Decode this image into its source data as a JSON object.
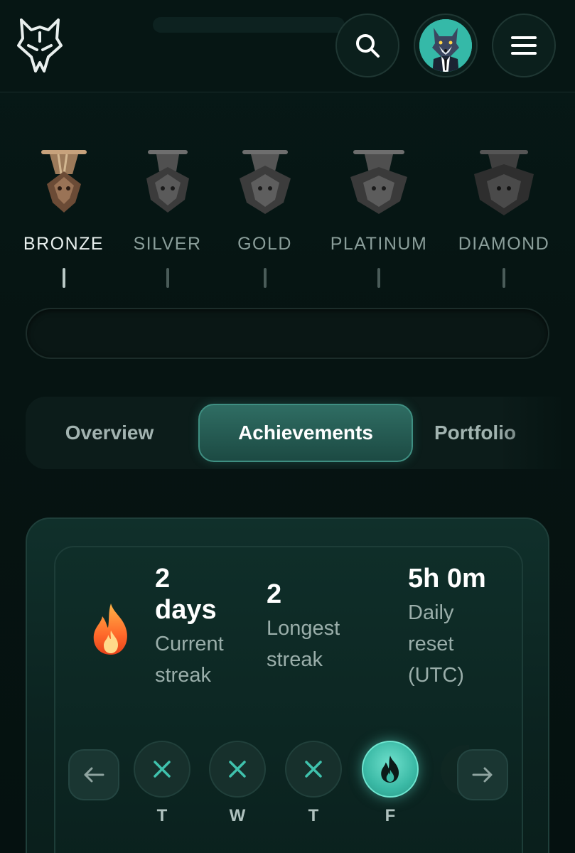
{
  "header": {
    "logo_icon": "wolf-logo-icon",
    "search_icon": "search-icon",
    "avatar_icon": "wolf-avatar",
    "menu_icon": "hamburger-menu-icon"
  },
  "tiers": [
    {
      "label": "BRONZE",
      "active": true,
      "color": "#8a6a4e"
    },
    {
      "label": "SILVER",
      "active": false,
      "color": "#6a6a6a"
    },
    {
      "label": "GOLD",
      "active": false,
      "color": "#6a6a6a"
    },
    {
      "label": "PLATINUM",
      "active": false,
      "color": "#6a6a6a"
    },
    {
      "label": "DIAMOND",
      "active": false,
      "color": "#555555"
    }
  ],
  "tier_progress": 0,
  "tabs": {
    "overview": "Overview",
    "achievements": "Achievements",
    "portfolio": "Portfolio",
    "active": "achievements"
  },
  "streak": {
    "flame_icon": "flame-icon",
    "current": {
      "value_num": "2",
      "value_unit": "days",
      "caption_line1": "Current",
      "caption_line2": "streak"
    },
    "longest": {
      "value": "2",
      "caption_line1": "Longest",
      "caption_line2": "streak"
    },
    "reset": {
      "value": "5h 0m",
      "caption_line1": "Daily",
      "caption_line2": "reset",
      "caption_line3": "(UTC)"
    }
  },
  "days": [
    {
      "letter": "T",
      "status": "missed",
      "icon": "x-icon"
    },
    {
      "letter": "W",
      "status": "missed",
      "icon": "x-icon"
    },
    {
      "letter": "T",
      "status": "missed",
      "icon": "x-icon"
    },
    {
      "letter": "F",
      "status": "done",
      "icon": "flame-icon"
    }
  ],
  "colors": {
    "accent": "#3ab9a5",
    "background": "#061513",
    "miss_x": "#3fc2ad"
  }
}
